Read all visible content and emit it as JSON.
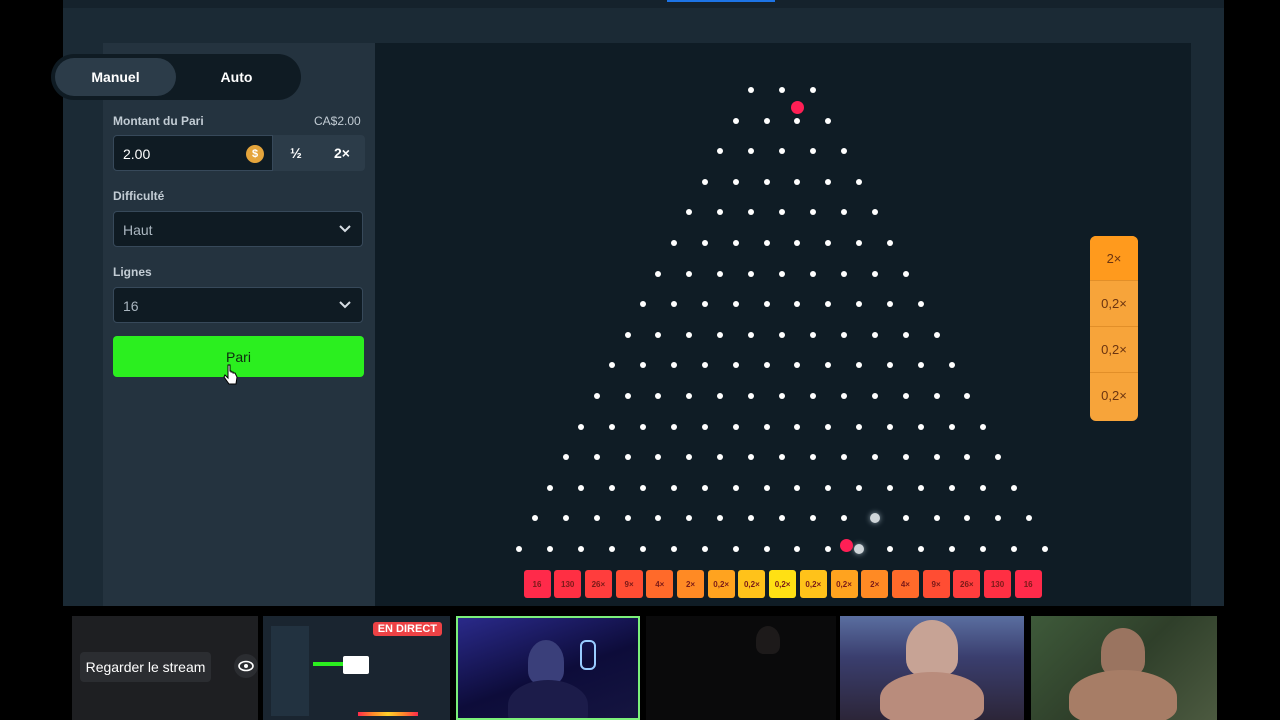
{
  "game": {
    "modes": [
      "Manuel",
      "Auto"
    ],
    "active_mode": "Manuel",
    "bet_amount_label": "Montant du Pari",
    "bet_amount_converted": "CA$2.00",
    "bet_amount_value": "2.00",
    "currency_icon": "coin-icon",
    "half_label": "½",
    "double_label": "2×",
    "difficulty_label": "Difficulté",
    "difficulty_value": "Haut",
    "lines_label": "Lignes",
    "lines_value": "16",
    "bet_button": "Pari"
  },
  "board": {
    "rows": 16,
    "multipliers": [
      "16",
      "130",
      "26×",
      "9×",
      "4×",
      "2×",
      "0,2×",
      "0,2×",
      "0,2×",
      "0,2×",
      "0,2×",
      "2×",
      "4×",
      "9×",
      "26×",
      "130",
      "16"
    ],
    "bucket_colors": [
      "#ff2a4a",
      "#ff2f43",
      "#ff3d3d",
      "#ff4d33",
      "#ff6a2a",
      "#ff8a24",
      "#ffa31f",
      "#ffc21a",
      "#ffe014",
      "#ffc21a",
      "#ffa31f",
      "#ff8a24",
      "#ff6a2a",
      "#ff4d33",
      "#ff3d3d",
      "#ff2f43",
      "#ff2a4a"
    ],
    "ball_color": "#ff1f55"
  },
  "history": [
    "2×",
    "0,2×",
    "0,2×",
    "0,2×"
  ],
  "stream": {
    "watch_button": "Regarder le stream",
    "live_badge": "EN DIRECT"
  }
}
